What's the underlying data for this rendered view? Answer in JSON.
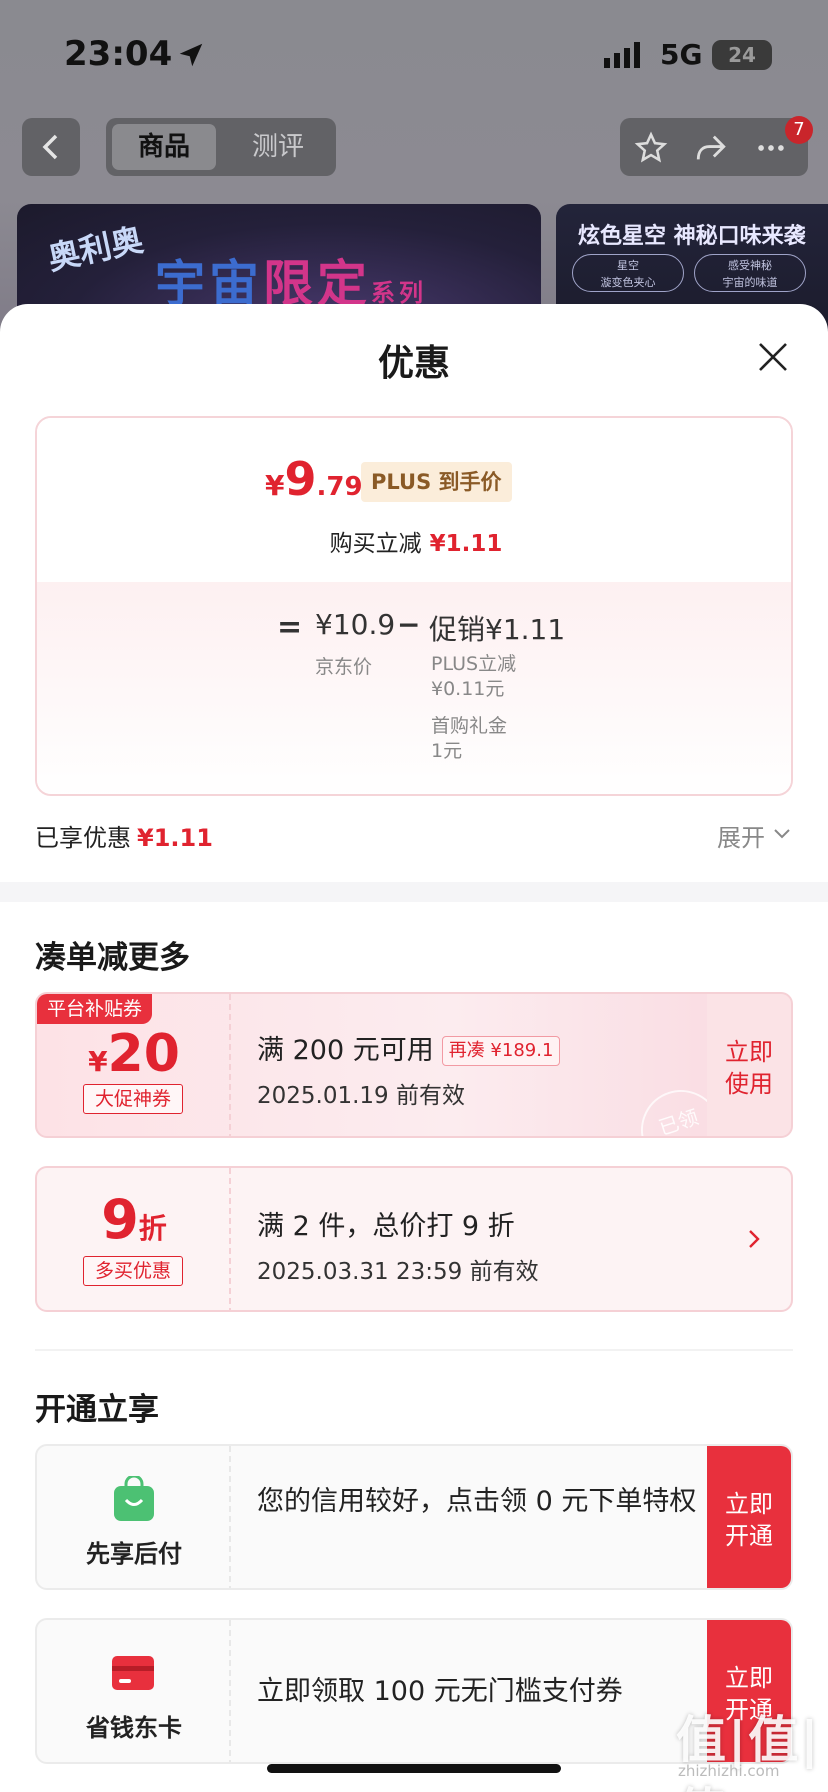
{
  "status_bar": {
    "time": "23:04",
    "network": "5G",
    "battery": "24"
  },
  "nav": {
    "tabs": [
      {
        "label": "商品",
        "active": true
      },
      {
        "label": "测评",
        "active": false
      }
    ],
    "notification_count": "7"
  },
  "banner": {
    "brand": "奥利奥",
    "title_part1": "宇宙",
    "title_part2": "限定",
    "title_suffix": "系列",
    "right_title": "炫色星空 神秘口味来袭",
    "right_pill_1": "星空\n漩变色夹心",
    "right_pill_2": "感受神秘\n宇宙的味道"
  },
  "sheet": {
    "title": "优惠",
    "price": {
      "currency": "¥",
      "int": "9",
      "dec": ".79",
      "tag": "PLUS 到手价"
    },
    "reduce_label": "购买立减",
    "reduce_amount": "¥1.11",
    "breakdown": {
      "eq": "=",
      "jd_price": "¥10.9",
      "jd_label": "京东价",
      "minus": "−",
      "promo_total": "促销¥1.11",
      "promo_items": [
        {
          "name": "PLUS立减",
          "amount": "¥0.11元"
        },
        {
          "name": "首购礼金",
          "amount": "1元"
        }
      ]
    },
    "enjoyed_label": "已享优惠",
    "enjoyed_amount": "¥1.11",
    "expand_label": "展开"
  },
  "more_section": {
    "title": "凑单减更多",
    "coupons": [
      {
        "tag": "平台补贴券",
        "value_currency": "¥",
        "value": "20",
        "sub": "大促神券",
        "main": "满 200 元可用",
        "again": "再凑 ¥189.1",
        "date": "2025.01.19 前有效",
        "action": "立即\n使用",
        "stamp": "已领"
      },
      {
        "value": "9",
        "value_unit": "折",
        "sub": "多买优惠",
        "main": "满 2 件，总价打 9 折",
        "date": "2025.03.31 23:59 前有效"
      }
    ]
  },
  "open_section": {
    "title": "开通立享",
    "services": [
      {
        "icon": "shopping-bag-icon",
        "name": "先享后付",
        "text": "您的信用较好，点击领 0 元下单特权",
        "action": "立即\n开通",
        "color": "#4cc173"
      },
      {
        "icon": "card-icon",
        "name": "省钱东卡",
        "text": "立即领取 100 元无门槛支付券",
        "action": "立即\n开通",
        "color": "#e8303d"
      }
    ]
  },
  "watermark": {
    "main": "值|值|值",
    "sub": "zhizhizhi.com"
  },
  "colors": {
    "accent_red": "#e0232f",
    "coupon_bg": "#fdf3f4",
    "plus_tag_bg": "#fbedda"
  }
}
